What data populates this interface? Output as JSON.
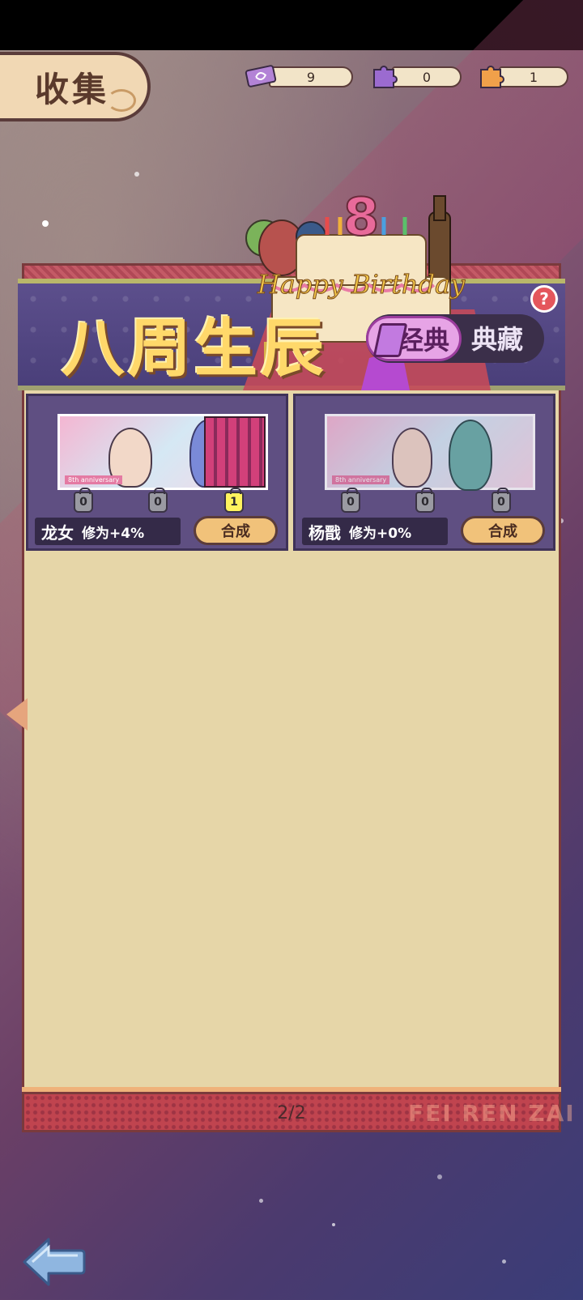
{
  "header": {
    "title": "收集"
  },
  "resources": [
    {
      "name": "ticket",
      "icon": "ticket-icon",
      "value": "9",
      "color": "#b383d6"
    },
    {
      "name": "purple-puzzle",
      "icon": "purple-puzzle-icon",
      "value": "0",
      "color": "#9b6bd0"
    },
    {
      "name": "orange-puzzle",
      "icon": "orange-puzzle-icon",
      "value": "1",
      "color": "#f0a04a"
    }
  ],
  "banner": {
    "title": "八周生辰",
    "cake_number": "8",
    "cake_text": "Happy Birthday",
    "tabs": [
      {
        "label": "经典",
        "active": true
      },
      {
        "label": "典藏",
        "active": false
      }
    ],
    "help_label": "?"
  },
  "cards": [
    {
      "name": "龙女",
      "bonus": "修为+4%",
      "slots": [
        "0",
        "0",
        "1"
      ],
      "merge_label": "合成",
      "art_label": "8th anniversary"
    },
    {
      "name": "杨戬",
      "bonus": "修为+0%",
      "slots": [
        "0",
        "0",
        "0"
      ],
      "merge_label": "合成",
      "art_label": "8th anniversary"
    }
  ],
  "footer": {
    "page": "2/2",
    "watermark": "FEI REN ZAI"
  }
}
